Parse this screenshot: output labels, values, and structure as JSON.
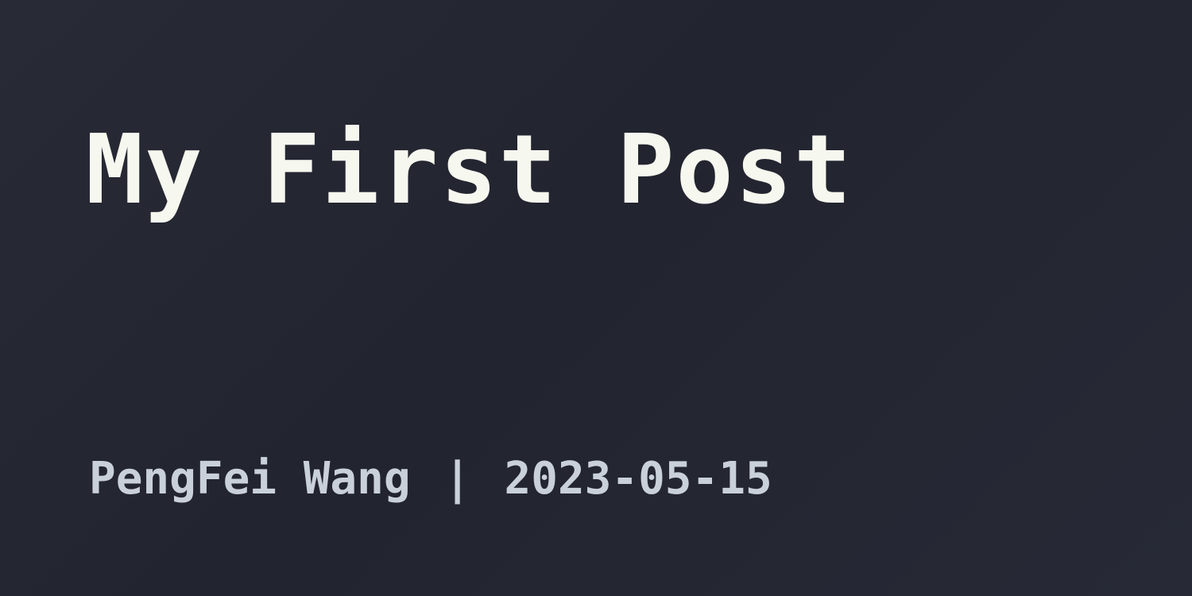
{
  "post": {
    "title": "My First Post",
    "author": "PengFei Wang",
    "separator": "|",
    "date": "2023-05-15"
  },
  "colors": {
    "background": "#252733",
    "title": "#f6f7ef",
    "meta": "#c9d0da"
  }
}
